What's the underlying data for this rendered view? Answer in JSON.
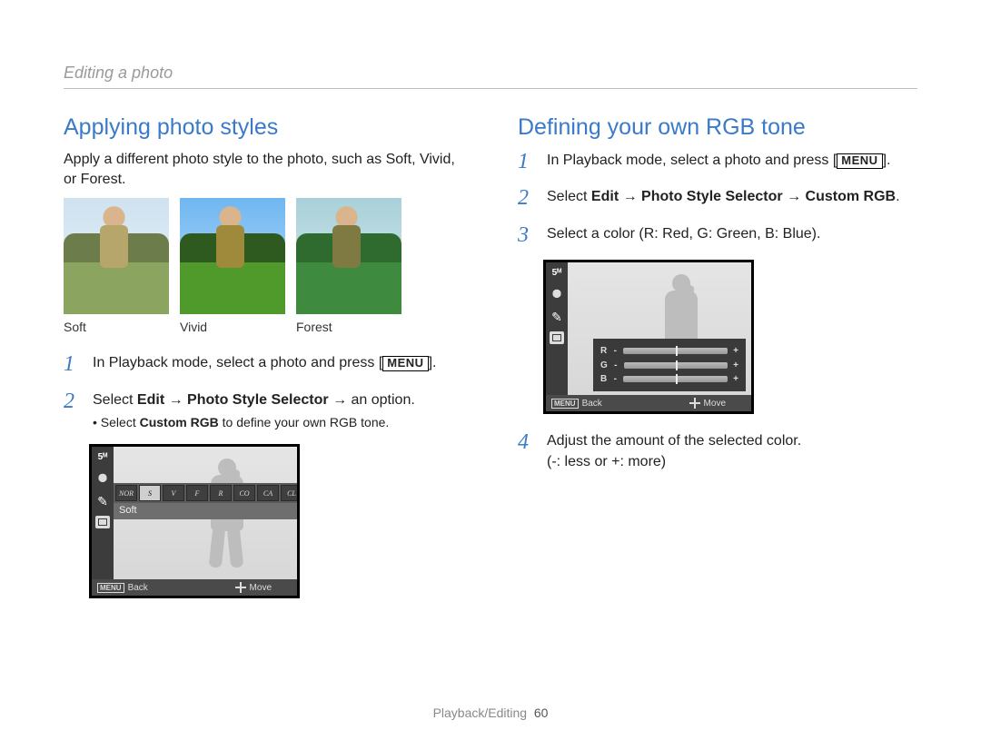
{
  "breadcrumb": "Editing a photo",
  "left": {
    "title": "Applying photo styles",
    "intro": "Apply a different photo style to the photo, such as Soft, Vivid, or Forest.",
    "thumb_labels": [
      "Soft",
      "Vivid",
      "Forest"
    ],
    "steps": [
      {
        "num": "1",
        "pre": "In Playback mode, select a photo and press [",
        "post": "].",
        "menu": "MENU"
      },
      {
        "num": "2",
        "pre": "Select ",
        "b1": "Edit",
        "arr1": " → ",
        "b2": "Photo Style Selector",
        "arr2": " → ",
        "tail": "an option.",
        "sub_pre": "Select ",
        "sub_b": "Custom RGB",
        "sub_post": " to define your own RGB tone."
      }
    ],
    "lcd": {
      "chips": [
        "NOR",
        "S",
        "V",
        "F",
        "R",
        "CO",
        "CA",
        "CL"
      ],
      "style_label": "Soft",
      "back": "Back",
      "move": "Move",
      "menu": "MENU"
    }
  },
  "right": {
    "title": "Defining your own RGB tone",
    "steps": [
      {
        "num": "1",
        "pre": "In Playback mode, select a photo and press [",
        "post": "].",
        "menu": "MENU"
      },
      {
        "num": "2",
        "pre": "Select ",
        "b1": "Edit",
        "arr1": " → ",
        "b2": "Photo Style Selector",
        "arr2": " → ",
        "b3": "Custom RGB",
        "tail": "."
      },
      {
        "num": "3",
        "text": "Select a color (R: Red, G: Green, B: Blue)."
      },
      {
        "num": "4",
        "line1": "Adjust the amount of the selected color.",
        "line2": "(-: less or +: more)"
      }
    ],
    "lcd": {
      "rows": [
        "R",
        "G",
        "B"
      ],
      "minus": "-",
      "plus": "+",
      "back": "Back",
      "move": "Move",
      "menu": "MENU"
    }
  },
  "footer": {
    "section": "Playback/Editing",
    "page": "60"
  }
}
